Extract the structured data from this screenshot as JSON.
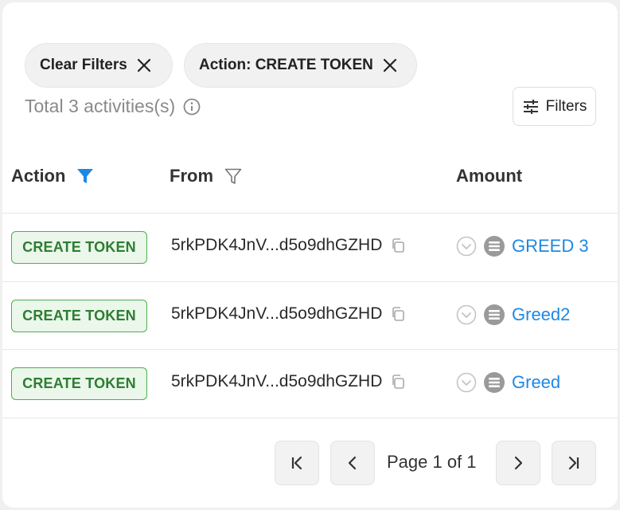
{
  "filters": {
    "chips": [
      {
        "label": "Clear Filters"
      },
      {
        "label": "Action: CREATE TOKEN"
      }
    ],
    "total_text": "Total 3 activities(s)",
    "filters_button": "Filters"
  },
  "table": {
    "headers": {
      "action": "Action",
      "from": "From",
      "amount": "Amount"
    },
    "rows": [
      {
        "action": "CREATE TOKEN",
        "from": "5rkPDK4JnV...d5o9dhGZHD",
        "token": "GREED 3"
      },
      {
        "action": "CREATE TOKEN",
        "from": "5rkPDK4JnV...d5o9dhGZHD",
        "token": "Greed2"
      },
      {
        "action": "CREATE TOKEN",
        "from": "5rkPDK4JnV...d5o9dhGZHD",
        "token": "Greed"
      }
    ]
  },
  "pagination": {
    "text": "Page 1 of 1"
  },
  "colors": {
    "accent": "#1e88e5",
    "badge_border": "#4caf50",
    "badge_text": "#2e7d32"
  }
}
